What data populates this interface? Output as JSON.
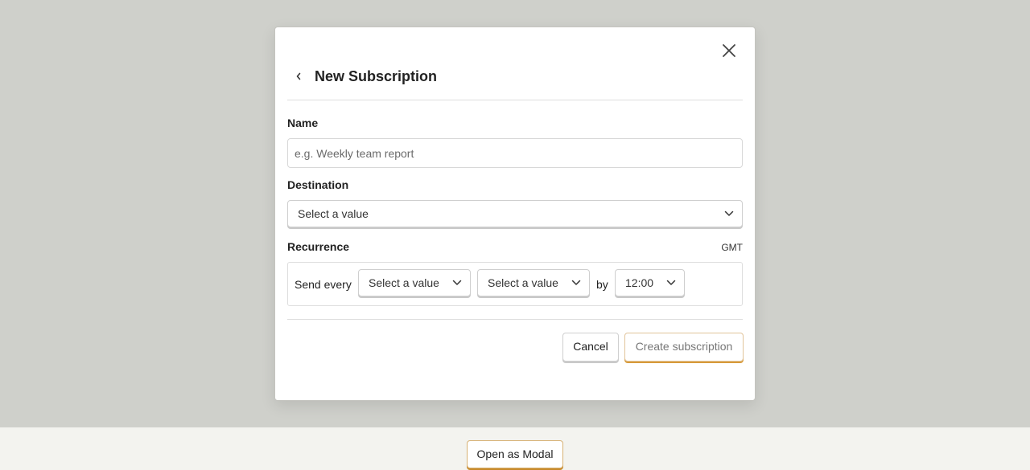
{
  "modal": {
    "title": "New Subscription",
    "name_label": "Name",
    "name_placeholder": "e.g. Weekly team report",
    "name_value": "",
    "destination_label": "Destination",
    "destination_select": "Select a value",
    "recurrence_label": "Recurrence",
    "timezone": "GMT",
    "recurrence": {
      "send_every_label": "Send every",
      "select_1": "Select a value",
      "select_2": "Select a value",
      "by_label": "by",
      "time_select": "12:00"
    },
    "cancel_label": "Cancel",
    "create_label": "Create subscription"
  },
  "page": {
    "open_modal_label": "Open as Modal"
  },
  "icons": {
    "close": "close-icon",
    "back": "chevron-left-icon",
    "dropdown": "chevron-down-icon"
  },
  "colors": {
    "overlay": "#cfd0cb",
    "primary_accent": "#d79a3a",
    "border": "#dedede"
  }
}
